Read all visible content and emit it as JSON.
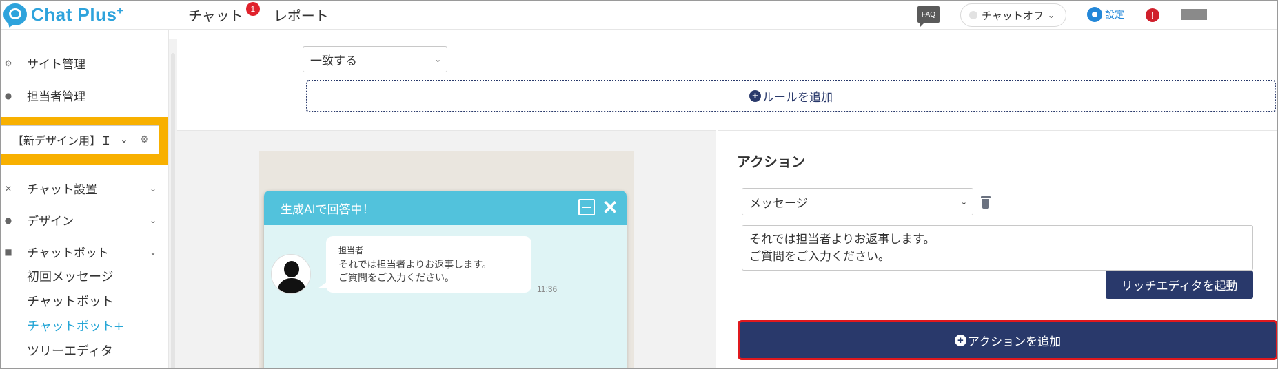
{
  "header": {
    "logo_text": "Chat Plus",
    "logo_sup": "+",
    "nav": [
      {
        "label": "チャット",
        "badge": "1"
      },
      {
        "label": "レポート"
      }
    ],
    "faq_label": "FAQ",
    "chat_toggle_label": "チャットオフ",
    "settings_label": "設定",
    "alert_label": "!"
  },
  "sidebar": {
    "items": [
      {
        "label": "サイト管理",
        "icon": "gear-icon"
      },
      {
        "label": "担当者管理",
        "icon": "users-icon"
      }
    ],
    "site_select": "【新デザイン用】Ｉ",
    "sections": [
      {
        "label": "チャット設置",
        "icon": "tools-icon"
      },
      {
        "label": "デザイン",
        "icon": "palette-icon"
      },
      {
        "label": "チャットボット",
        "icon": "chat-icon"
      }
    ],
    "sub_items": [
      {
        "label": "初回メッセージ"
      },
      {
        "label": "チャットボット"
      },
      {
        "label": "チャットボット+"
      },
      {
        "label": "ツリーエディタ"
      }
    ],
    "active_sub": "チャットボット+"
  },
  "rules": {
    "match_select": "一致する",
    "add_rule_label": "ルールを追加"
  },
  "preview": {
    "window_title": "生成AIで回答中！",
    "sender_name": "担当者",
    "message": "それでは担当者よりお返事します。\nご質問をご入力ください。",
    "time": "11:36"
  },
  "action": {
    "title": "アクション",
    "type_select": "メッセージ",
    "message_text": "それでは担当者よりお返事します。\nご質問をご入力ください。",
    "rich_editor_label": "リッチエディタを起動",
    "add_action_label": "アクションを追加"
  },
  "colors": {
    "brand": "#2ea3dc",
    "navy": "#29396b",
    "highlight": "#f8b000",
    "alert": "#e0191e",
    "chat_header": "#52c2dc"
  }
}
